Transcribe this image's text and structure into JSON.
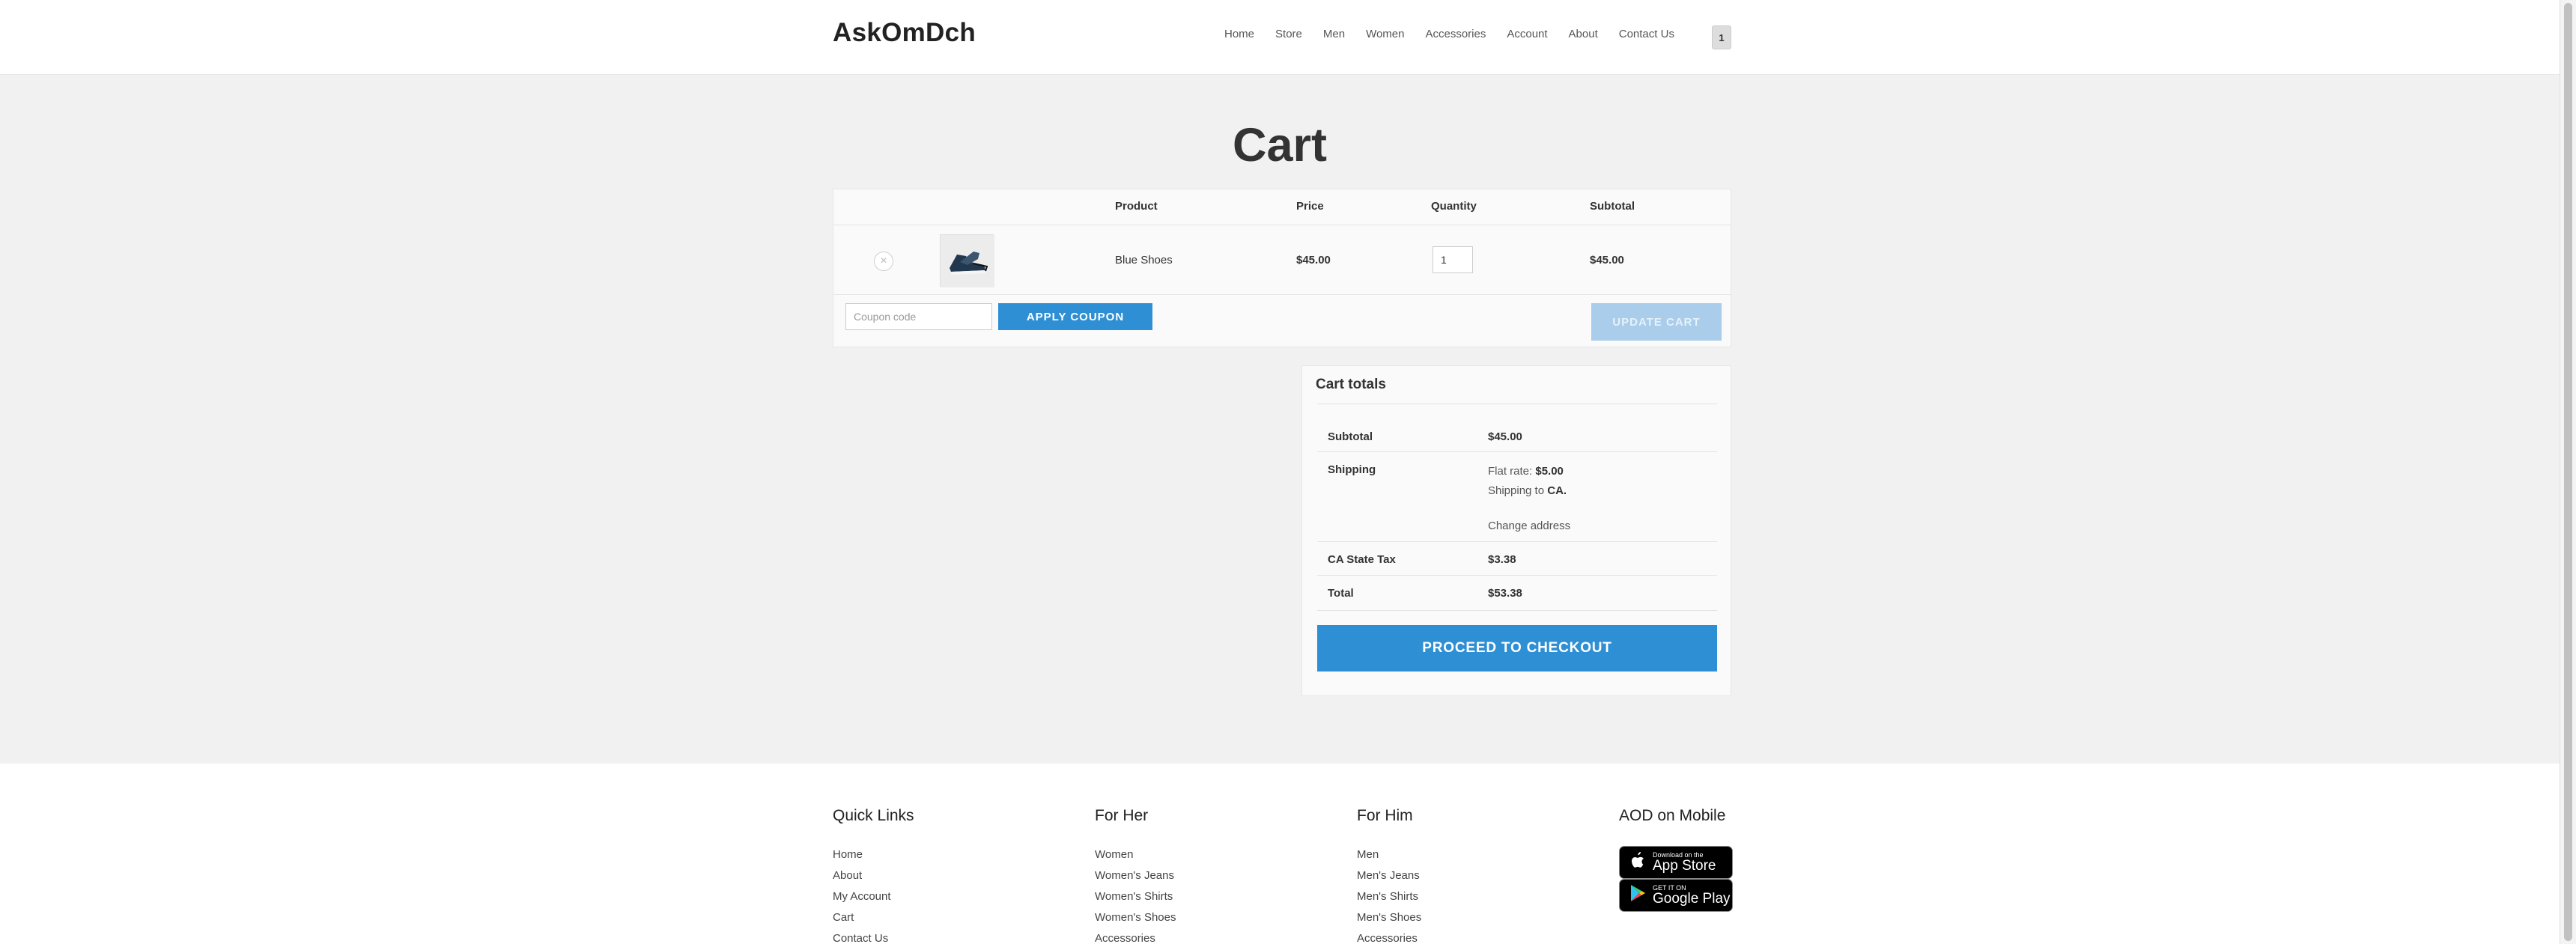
{
  "site": {
    "logo": "AskOmDch"
  },
  "nav": {
    "items": [
      "Home",
      "Store",
      "Men",
      "Women",
      "Accessories",
      "Account",
      "About",
      "Contact Us"
    ],
    "cart_count": "1"
  },
  "page": {
    "title": "Cart"
  },
  "cart": {
    "headers": {
      "product": "Product",
      "price": "Price",
      "quantity": "Quantity",
      "subtotal": "Subtotal"
    },
    "item": {
      "remove": "×",
      "product": "Blue Shoes",
      "price": "$45.00",
      "quantity": "1",
      "subtotal": "$45.00"
    },
    "coupon_placeholder": "Coupon code",
    "apply_label": "APPLY COUPON",
    "update_label": "UPDATE CART"
  },
  "totals": {
    "title": "Cart totals",
    "subtotal_label": "Subtotal",
    "subtotal_value": "$45.00",
    "shipping_label": "Shipping",
    "flat_rate_label": "Flat rate: ",
    "flat_rate_value": "$5.00",
    "shipping_to_label": "Shipping to ",
    "shipping_to_value": "CA.",
    "change_address": "Change address",
    "tax_label": "CA State Tax",
    "tax_value": "$3.38",
    "total_label": "Total",
    "total_value": "$53.38",
    "checkout_label": "PROCEED TO CHECKOUT"
  },
  "footer": {
    "quick_links": {
      "title": "Quick Links",
      "items": [
        "Home",
        "About",
        "My Account",
        "Cart",
        "Contact Us"
      ]
    },
    "for_her": {
      "title": "For Her",
      "items": [
        "Women",
        "Women's Jeans",
        "Women's Shirts",
        "Women's Shoes",
        "Accessories"
      ]
    },
    "for_him": {
      "title": "For Him",
      "items": [
        "Men",
        "Men's Jeans",
        "Men's Shirts",
        "Men's Shoes",
        "Accessories"
      ]
    },
    "mobile": {
      "title": "AOD on Mobile",
      "app_store_small": "Download on the",
      "app_store_big": "App Store",
      "play_small": "GET IT ON",
      "play_big": "Google Play"
    }
  },
  "colors": {
    "accent": "#2e8fd4",
    "update_disabled": "#a9cdea"
  },
  "icons": {
    "remove": "close-circle-icon",
    "apple": "apple-icon",
    "play": "play-store-icon"
  }
}
